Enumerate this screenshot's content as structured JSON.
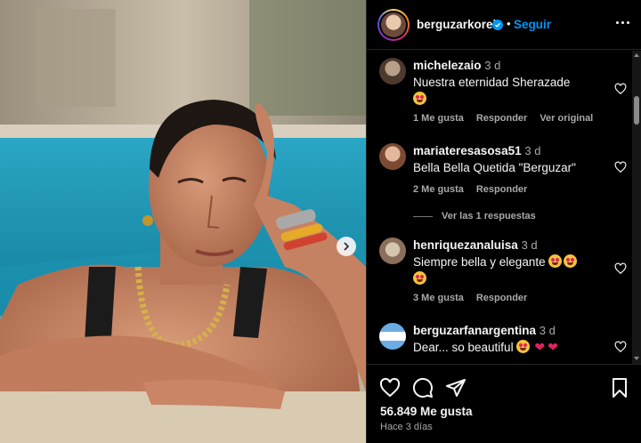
{
  "post": {
    "username": "berguzarkorel",
    "follow_label": "Seguir",
    "separator": "•",
    "likes": "56.849 Me gusta",
    "time_ago": "Hace 3 días"
  },
  "icons": {
    "verified": "verified-badge-icon",
    "more": "more-options-icon",
    "like": "heart-icon",
    "comment": "comment-icon",
    "share": "share-icon",
    "save": "bookmark-icon",
    "next": "chevron-right-icon"
  },
  "colors": {
    "accent": "#0095f6",
    "background": "#000000",
    "muted": "#a8a8a8"
  },
  "comments": [
    {
      "username": "michelezaio",
      "time": "3 d",
      "text": "Nuestra eternidad Sherazade",
      "emoji": "heart-eyes-emoji",
      "likes": "1 Me gusta",
      "reply": "Responder",
      "extra": "Ver original"
    },
    {
      "username": "mariateresasosa51",
      "time": "3 d",
      "text": "Bella Bella Quetida \"Berguzar\"",
      "likes": "2 Me gusta",
      "reply": "Responder",
      "view_replies": "Ver las 1 respuestas"
    },
    {
      "username": "henriquezanaluisa",
      "time": "3 d",
      "text": "Siempre bella y elegante",
      "likes": "3 Me gusta",
      "reply": "Responder"
    },
    {
      "username": "berguzarfanargentina",
      "time": "3 d",
      "text": "Dear... so beautiful"
    }
  ]
}
